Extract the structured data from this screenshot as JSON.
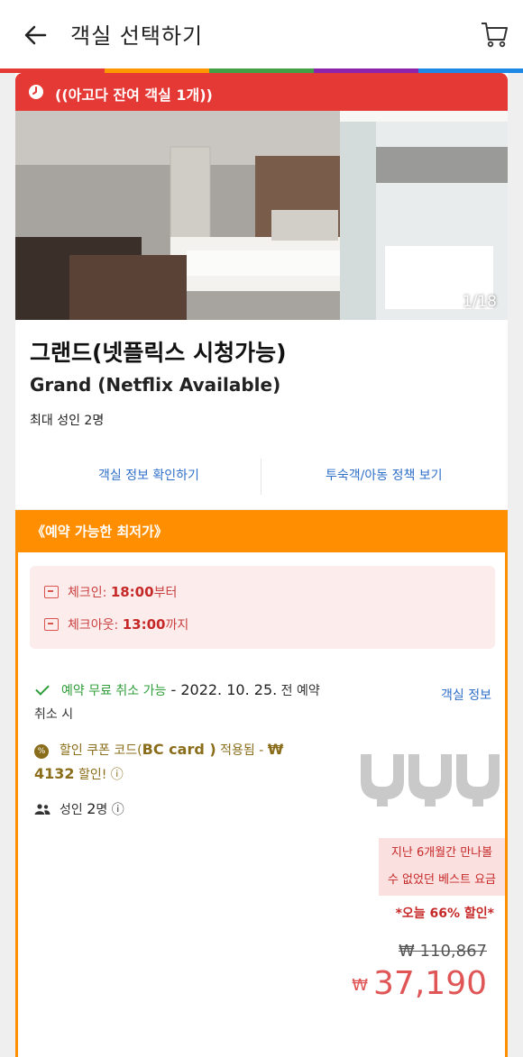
{
  "header": {
    "title": "객실 선택하기",
    "back_icon": "arrow-left-icon",
    "cart_icon": "cart-icon"
  },
  "rainbow_colors": [
    "#e53935",
    "#ff9800",
    "#43a047",
    "#8e24aa",
    "#1e88e5"
  ],
  "room": {
    "urgent_text": "((아고다 잔여 객실 1개))",
    "urgent_color": "#e53935",
    "photo_counter": "1/18",
    "name_ko": "그랜드(넷플릭스 시청가능)",
    "name_en": "Grand (Netflix Available)",
    "max_occupancy": "최대 성인 2명",
    "links": {
      "room_info": "객실 정보 확인하기",
      "policy": "투숙객/아동 정책 보기"
    }
  },
  "rate": {
    "header": "《예약 가능한 최저가》",
    "header_color": "#ff8f00",
    "checkin_label": "체크인:",
    "checkin_time": "18:00",
    "checkin_suffix": "부터",
    "checkout_label": "체크아웃:",
    "checkout_time": "13:00",
    "checkout_suffix": "까지",
    "free_cancel": "예약 무료 취소 가능",
    "cancel_date": " - 2022. 10. 25.",
    "cancel_suffix": " 전 예약 취소 시",
    "coupon_prefix": "할인 쿠폰 코드(",
    "coupon_code": "BC card )",
    "coupon_mid": " 적용됨 - ",
    "coupon_amount": "₩ 4132",
    "coupon_suffix": " 할인! ⓘ",
    "adults_prefix": "성인 ",
    "adults_count": "2",
    "adults_suffix": "명 ⓘ",
    "room_info_link": "객실 정보",
    "best_line1": "지난 6개월간 만나볼",
    "best_line2": "수 없었던 베스트 요금",
    "discount_text": "*오늘 66% 할인*",
    "original_price": "₩ 110,867",
    "currency": "₩",
    "final_price": "37,190"
  }
}
